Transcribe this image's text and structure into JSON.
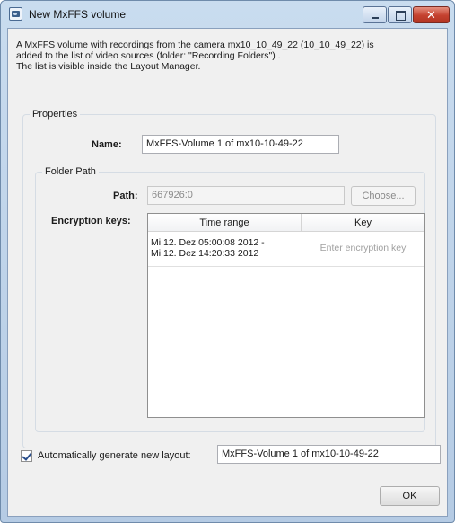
{
  "window": {
    "title": "New MxFFS volume",
    "close_glyph": "✕"
  },
  "intro": {
    "line1": "A MxFFS volume with recordings from the camera mx10_10_49_22 (10_10_49_22) is",
    "line2": "added to the list of video sources (folder: \"Recording Folders\") .",
    "line3": "The list is visible inside the Layout Manager."
  },
  "properties": {
    "legend": "Properties",
    "name_label": "Name:",
    "name_value": "MxFFS-Volume 1 of mx10-10-49-22",
    "folder_path": {
      "legend": "Folder Path",
      "path_label": "Path:",
      "path_value": "667926:0",
      "choose_label": "Choose...",
      "encryption_label": "Encryption keys:",
      "table": {
        "columns": [
          "Time range",
          "Key"
        ],
        "rows": [
          {
            "time_line1": "Mi 12. Dez 05:00:08 2012 -",
            "time_line2": "Mi 12. Dez 14:20:33 2012",
            "key_placeholder": "Enter encryption key"
          }
        ]
      }
    }
  },
  "layout": {
    "auto_generate_label": "Automatically generate new layout:",
    "auto_generate_checked": true,
    "layout_name": "MxFFS-Volume 1 of mx10-10-49-22"
  },
  "ok_label": "OK",
  "icons": {
    "app": "camera-icon",
    "minimize": "minimize-icon",
    "maximize": "maximize-icon",
    "close": "close-icon",
    "check": "checkmark-icon"
  }
}
